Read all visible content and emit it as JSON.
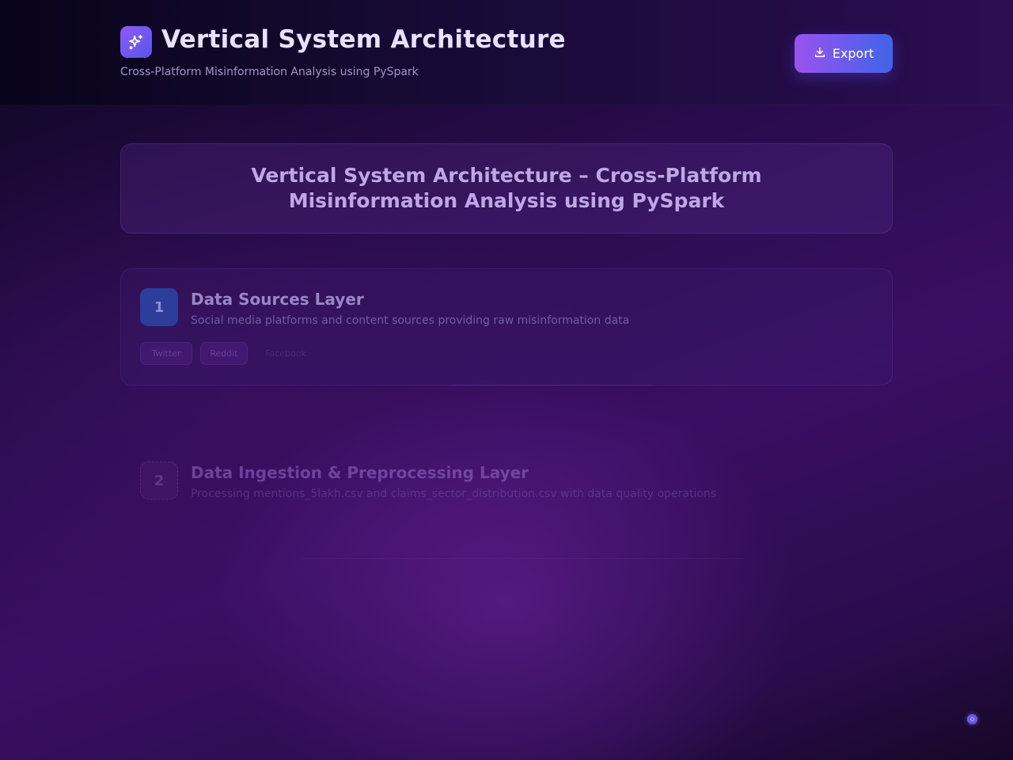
{
  "header": {
    "title": "Vertical System Architecture",
    "subtitle": "Cross-Platform Misinformation Analysis using PySpark",
    "brand_icon": "sparkles-icon",
    "export_label": "Export",
    "export_icon": "download-icon"
  },
  "main": {
    "heading": "Vertical System Architecture – Cross-Platform Misinformation Analysis using PySpark",
    "layers": [
      {
        "number": "1",
        "title": "Data Sources Layer",
        "description": "Social media platforms and content sources providing raw misinformation data",
        "chips": [
          "Twitter",
          "Reddit",
          "Facebook"
        ]
      },
      {
        "number": "2",
        "title": "Data Ingestion & Preprocessing Layer",
        "description": "Processing mentions_5lakh.csv and claims_sector_distribution.csv with data quality operations"
      }
    ]
  },
  "colors": {
    "accent_start": "#9a52ee",
    "accent_end": "#3f64e9",
    "background": "#2a0c4e"
  }
}
